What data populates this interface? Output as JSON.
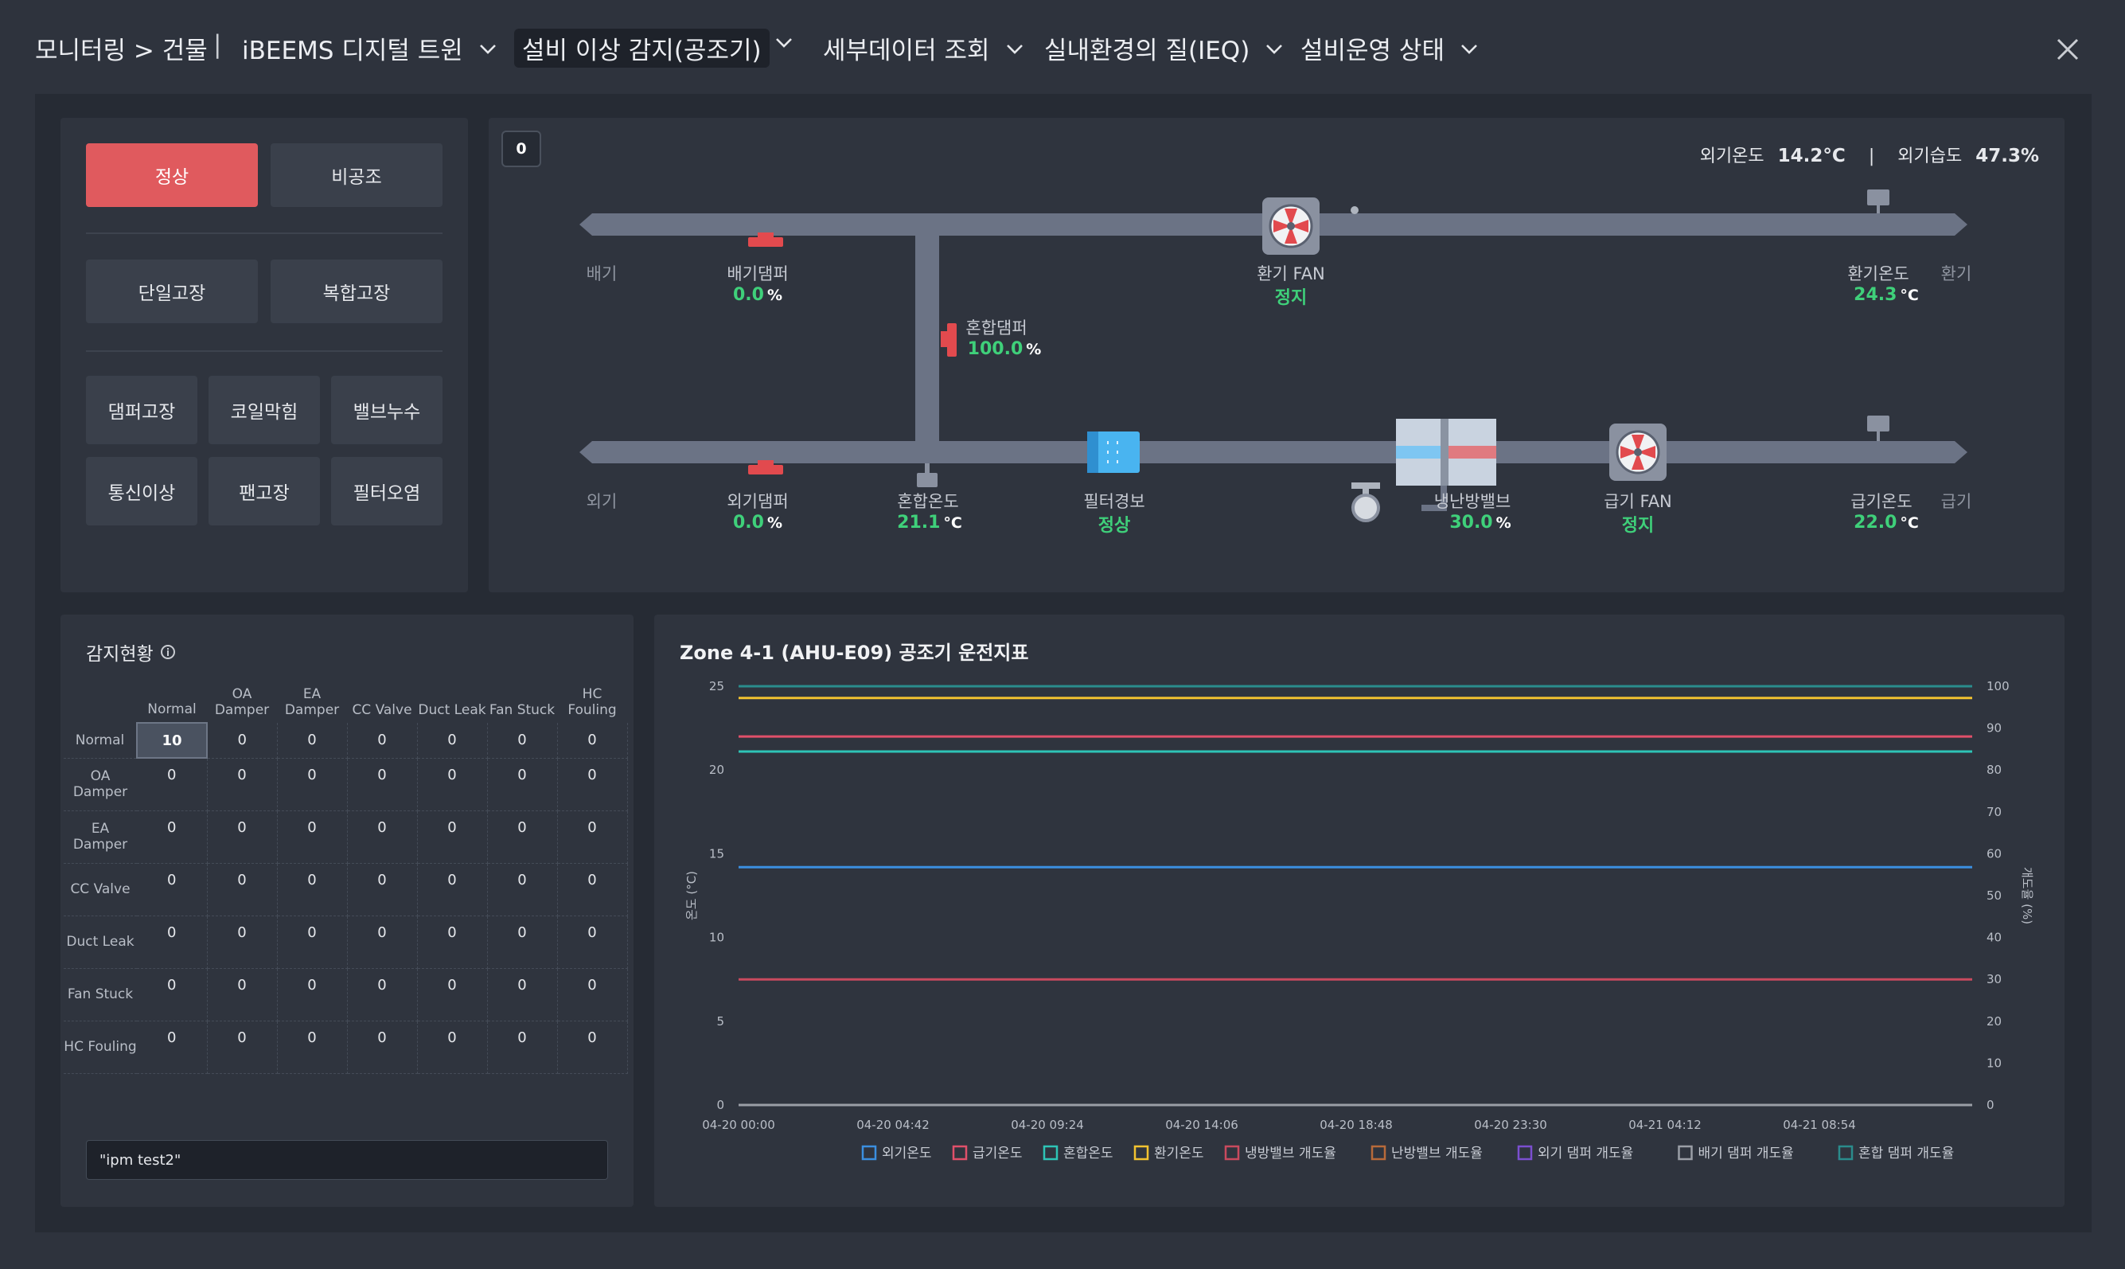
{
  "nav": {
    "breadcrumb": "모니터링 > 건물",
    "divider": "|",
    "items": [
      {
        "label": "iBEEMS 디지털 트윈"
      },
      {
        "label": "설비 이상 감지(공조기)"
      },
      {
        "label": "세부데이터 조회"
      },
      {
        "label": "실내환경의 질(IEQ)"
      },
      {
        "label": "설비운영 상태"
      }
    ]
  },
  "fault_panel": {
    "row1": [
      "정상",
      "비공조"
    ],
    "row2": [
      "단일고장",
      "복합고장"
    ],
    "row3": [
      "댐퍼고장",
      "코일막힘",
      "밸브누수"
    ],
    "row4": [
      "통신이상",
      "팬고장",
      "필터오염"
    ]
  },
  "diagram": {
    "badge": "0",
    "outdoor": {
      "temp_label": "외기온도",
      "temp": "14.2°C",
      "sep": "|",
      "hum_label": "외기습도",
      "hum": "47.3%"
    },
    "exhaust_label": "배기",
    "return_label": "환기",
    "outdoor_label": "외기",
    "supply_label": "급기",
    "ea_damper": {
      "label": "배기댐퍼",
      "value": "0.0",
      "unit": "%"
    },
    "return_fan": {
      "label": "환기 FAN",
      "status": "정지"
    },
    "return_temp": {
      "label": "환기온도",
      "value": "24.3",
      "unit": "°C"
    },
    "mix_damper": {
      "label": "혼합댐퍼",
      "value": "100.0",
      "unit": "%"
    },
    "oa_damper": {
      "label": "외기댐퍼",
      "value": "0.0",
      "unit": "%"
    },
    "mix_temp": {
      "label": "혼합온도",
      "value": "21.1",
      "unit": "°C"
    },
    "filter": {
      "label": "필터경보",
      "status": "정상"
    },
    "valve": {
      "label": "냉난방밸브",
      "value": "30.0",
      "unit": "%"
    },
    "supply_fan": {
      "label": "급기 FAN",
      "status": "정지"
    },
    "supply_temp": {
      "label": "급기온도",
      "value": "22.0",
      "unit": "°C"
    }
  },
  "detection": {
    "title": "감지현황",
    "columns": [
      "Normal",
      "OA Damper",
      "EA Damper",
      "CC Valve",
      "Duct Leak",
      "Fan Stuck",
      "HC Fouling"
    ],
    "rows": [
      {
        "label": "Normal",
        "values": [
          "10",
          "0",
          "0",
          "0",
          "0",
          "0",
          "0"
        ]
      },
      {
        "label": "OA Damper",
        "values": [
          "0",
          "0",
          "0",
          "0",
          "0",
          "0",
          "0"
        ]
      },
      {
        "label": "EA Damper",
        "values": [
          "0",
          "0",
          "0",
          "0",
          "0",
          "0",
          "0"
        ]
      },
      {
        "label": "CC Valve",
        "values": [
          "0",
          "0",
          "0",
          "0",
          "0",
          "0",
          "0"
        ]
      },
      {
        "label": "Duct Leak",
        "values": [
          "0",
          "0",
          "0",
          "0",
          "0",
          "0",
          "0"
        ]
      },
      {
        "label": "Fan Stuck",
        "values": [
          "0",
          "0",
          "0",
          "0",
          "0",
          "0",
          "0"
        ]
      },
      {
        "label": "HC Fouling",
        "values": [
          "0",
          "0",
          "0",
          "0",
          "0",
          "0",
          "0"
        ]
      }
    ],
    "input_value": "\"ipm test2\""
  },
  "chart": {
    "title": "Zone 4-1 (AHU-E09) 공조기 운전지표"
  },
  "chart_data": {
    "type": "line",
    "x": [
      "04-20 00:00",
      "04-20 04:42",
      "04-20 09:24",
      "04-20 14:06",
      "04-20 18:48",
      "04-20 23:30",
      "04-21 04:12",
      "04-21 08:54"
    ],
    "x_ticks": [
      "04-20 00:00",
      "04-20 04:42",
      "04-20 09:24",
      "04-20 14:06",
      "04-20 18:48",
      "04-20 23:30",
      "04-21 04:12",
      "04-21 08:54"
    ],
    "ylabel": "온도 (°C)",
    "y2label": "개도율 (%)",
    "ylim": [
      0,
      25
    ],
    "y2lim": [
      0,
      100
    ],
    "y_ticks": [
      0,
      5,
      10,
      15,
      20,
      25
    ],
    "y2_ticks": [
      0,
      10,
      20,
      30,
      40,
      50,
      60,
      70,
      80,
      90,
      100
    ],
    "grid": false,
    "legend": "bottom",
    "series": [
      {
        "name": "외기온도",
        "axis": "left",
        "color": "#3b8fe0",
        "values": [
          14.2,
          14.2,
          14.2,
          14.2,
          14.2,
          14.2,
          14.2,
          14.2
        ]
      },
      {
        "name": "급기온도",
        "axis": "left",
        "color": "#e0506a",
        "values": [
          22.0,
          22.0,
          22.0,
          22.0,
          22.0,
          22.0,
          22.0,
          22.0
        ]
      },
      {
        "name": "혼합온도",
        "axis": "left",
        "color": "#2ec4b6",
        "values": [
          21.1,
          21.1,
          21.1,
          21.1,
          21.1,
          21.1,
          21.1,
          21.1
        ]
      },
      {
        "name": "환기온도",
        "axis": "left",
        "color": "#f2c230",
        "values": [
          24.3,
          24.3,
          24.3,
          24.3,
          24.3,
          24.3,
          24.3,
          24.3
        ]
      },
      {
        "name": "냉방밸브 개도율",
        "axis": "right",
        "color": "#c94a5e",
        "values": [
          30,
          30,
          30,
          30,
          30,
          30,
          30,
          30
        ]
      },
      {
        "name": "난방밸브 개도율",
        "axis": "right",
        "color": "#b86a3a",
        "values": [
          0,
          0,
          0,
          0,
          0,
          0,
          0,
          0
        ]
      },
      {
        "name": "외기 댐퍼 개도율",
        "axis": "right",
        "color": "#7b4fd0",
        "values": [
          0,
          0,
          0,
          0,
          0,
          0,
          0,
          0
        ]
      },
      {
        "name": "배기 댐퍼 개도율",
        "axis": "right",
        "color": "#9a9ea6",
        "values": [
          0,
          0,
          0,
          0,
          0,
          0,
          0,
          0
        ]
      },
      {
        "name": "혼합 댐퍼 개도율",
        "axis": "right",
        "color": "#2a8c8c",
        "values": [
          100,
          100,
          100,
          100,
          100,
          100,
          100,
          100
        ]
      }
    ]
  }
}
